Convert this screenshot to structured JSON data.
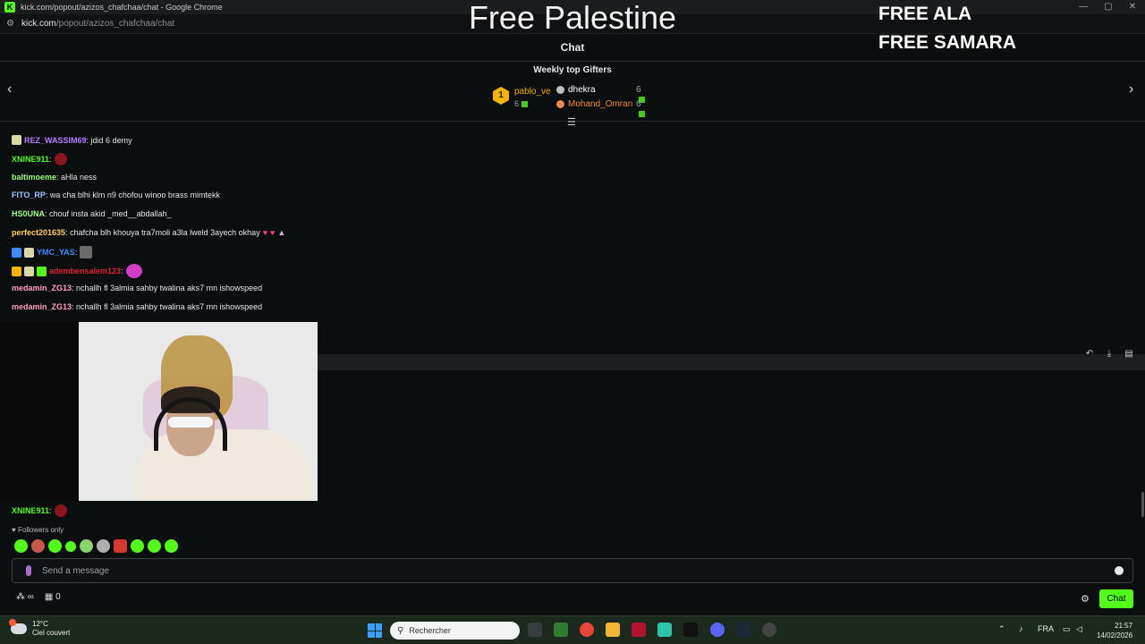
{
  "browser": {
    "title": "kick.com/popout/azizos_chafchaa/chat - Google Chrome",
    "url_host": "kick.com",
    "url_path": "/popout/azizos_chafchaa/chat"
  },
  "overlay": {
    "title": "Free Palestine",
    "free_ala": "FREE ALA",
    "free_samara": "FREE SAMARA"
  },
  "chat": {
    "header": "Chat",
    "gifters_title": "Weekly top Gifters",
    "gifters": [
      {
        "rank": "1",
        "name": "pablo_ve",
        "count": "6"
      },
      {
        "name": "dhekra",
        "count": "6"
      },
      {
        "name": "Mohand_Omran",
        "count": "6"
      }
    ],
    "messages": [
      {
        "user": "REZ_WASSIM69",
        "text": "jdid 6 demy",
        "color": "#b57cff"
      },
      {
        "user": "XNINE911",
        "text": "",
        "color": "#53fc18"
      },
      {
        "user": "baltimoeme",
        "text": "aHla ness",
        "color": "#9bff80"
      },
      {
        "user": "FITO_RP",
        "text": "wa cha blhi klm n9 chofou winoo brass mimtekk",
        "color": "#9ec5ff"
      },
      {
        "user": "HS0UNA",
        "text": "chouf insta akid _med__abdallah_",
        "color": "#9bff80"
      },
      {
        "user": "perfect201635",
        "text": "chafcha blh khouya tra7moli a3la lweld 3ayech okhay",
        "color": "#ffcf5a"
      },
      {
        "user": "YMC_YAS",
        "text": "",
        "color": "#3b8cff"
      },
      {
        "user": "adembensalem123",
        "text": "",
        "color": "#e0203a"
      },
      {
        "user": "medamin_ZG13",
        "text": "nchallh fl 3almia sahby twalina aks7 mn ishowspeed",
        "color": "#ff9ec2"
      },
      {
        "user": "medamin_ZG13",
        "text": "nchallh fl 3almia sahby twalina aks7 mn ishowspeed",
        "color": "#ff9ec2"
      },
      {
        "user": "XNINE911",
        "text": "",
        "color": "#53fc18"
      }
    ],
    "followers_only": "Followers only",
    "input_placeholder": "Send a message",
    "gift_count": "0",
    "chat_button": "Chat"
  },
  "taskbar": {
    "temp": "12°C",
    "weather": "Ciel couvert",
    "search_placeholder": "Rechercher",
    "lang": "FRA",
    "time": "21:57",
    "date": "14/02/2026"
  }
}
